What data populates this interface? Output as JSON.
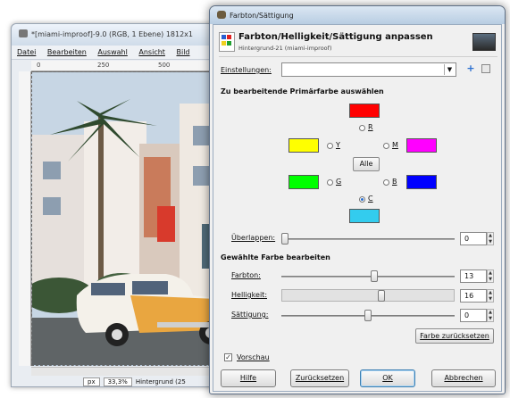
{
  "image_window": {
    "title": "*[miami-improof]-9.0 (RGB, 1 Ebene) 1812x1",
    "menu": [
      "Datei",
      "Bearbeiten",
      "Auswahl",
      "Ansicht",
      "Bild"
    ],
    "ruler_marks": [
      "0",
      "250",
      "500"
    ],
    "status": {
      "unit": "px",
      "zoom": "33,3%",
      "layer": "Hintergrund (25"
    }
  },
  "dialog": {
    "window_title": "Farbton/Sättigung",
    "header_title": "Farbton/Helligkeit/Sättigung anpassen",
    "header_subtitle": "Hintergrund-21 (miami-improof)",
    "presets_label": "Einstellungen:",
    "presets_value": "",
    "primary_heading": "Zu bearbeitende Primärfarbe auswählen",
    "colors": {
      "R": {
        "label": "R",
        "color": "#ff0000"
      },
      "Y": {
        "label": "Y",
        "color": "#ffff00"
      },
      "M": {
        "label": "M",
        "color": "#ff00ff"
      },
      "G": {
        "label": "G",
        "color": "#00ff00"
      },
      "B": {
        "label": "B",
        "color": "#0000ff"
      },
      "C": {
        "label": "C",
        "color": "#33ccee"
      }
    },
    "selected_color": "C",
    "all_button": "Alle",
    "overlap": {
      "label": "Überlappen:",
      "value": "0",
      "fraction": 0.0
    },
    "edit_heading": "Gewählte Farbe bearbeiten",
    "hue": {
      "label": "Farbton:",
      "value": "13",
      "fraction": 0.535
    },
    "lightness": {
      "label": "Helligkeit:",
      "value": "16",
      "fraction": 0.58
    },
    "saturation": {
      "label": "Sättigung:",
      "value": "0",
      "fraction": 0.5
    },
    "reset_color_button": "Farbe zurücksetzen",
    "preview_label": "Vorschau",
    "preview_checked": true,
    "buttons": {
      "help": "Hilfe",
      "reset": "Zurücksetzen",
      "ok": "OK",
      "cancel": "Abbrechen"
    }
  }
}
